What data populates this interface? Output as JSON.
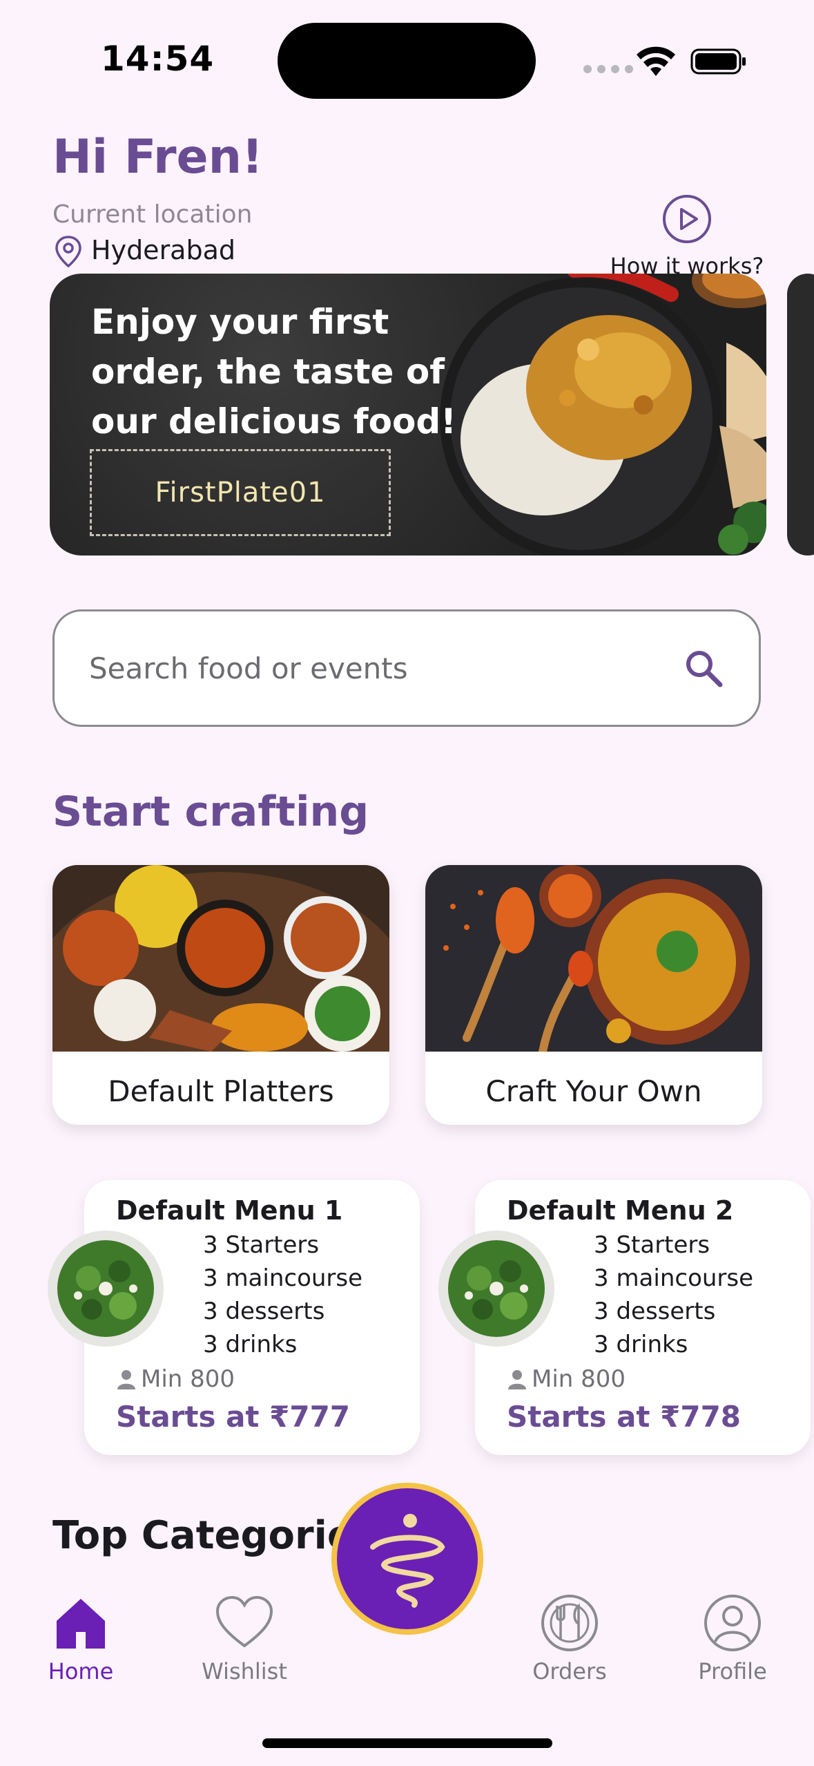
{
  "status_bar": {
    "time": "14:54"
  },
  "header": {
    "greeting": "Hi Fren!",
    "location_label": "Current location",
    "location_value": "Hyderabad",
    "how_it_works": "How it works?"
  },
  "banner": {
    "title": "Enjoy your first order, the taste of our delicious food!",
    "coupon_code": "FirstPlate01"
  },
  "search": {
    "placeholder": "Search food or events"
  },
  "start_crafting": {
    "title": "Start crafting",
    "cards": [
      {
        "label": "Default Platters"
      },
      {
        "label": "Craft Your Own"
      }
    ]
  },
  "menus": [
    {
      "title": "Default Menu 1",
      "lines": [
        "3 Starters",
        "3 maincourse",
        "3 desserts",
        "3 drinks"
      ],
      "min": "Min 800",
      "price": "Starts at ₹777"
    },
    {
      "title": "Default Menu 2",
      "lines": [
        "3 Starters",
        "3 maincourse",
        "3 desserts",
        "3 drinks"
      ],
      "min": "Min 800",
      "price": "Starts at ₹778"
    }
  ],
  "top_categories": {
    "title": "Top Categories"
  },
  "bottom_nav": {
    "items": [
      {
        "label": "Home",
        "icon": "home-icon",
        "active": true
      },
      {
        "label": "Wishlist",
        "icon": "heart-icon"
      },
      {
        "label": "Orders",
        "icon": "cutlery-icon"
      },
      {
        "label": "Profile",
        "icon": "profile-icon"
      }
    ]
  },
  "colors": {
    "accent": "#6a4c93",
    "nav_active": "#6a1fb5",
    "fab_ring": "#f4c247",
    "background": "#fcf3fc"
  }
}
